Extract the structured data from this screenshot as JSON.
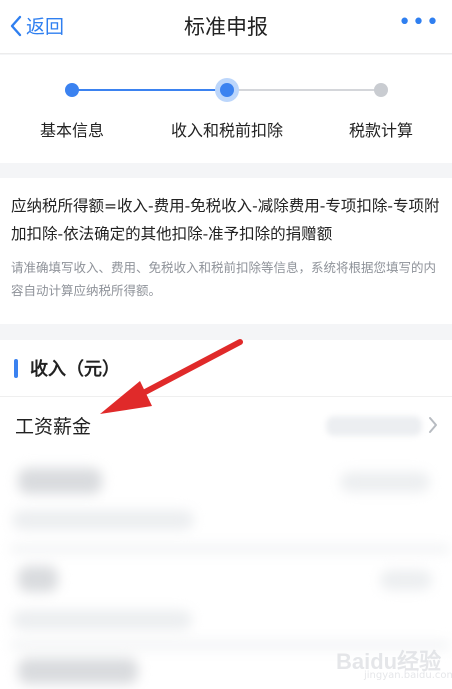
{
  "nav": {
    "back_label": "返回",
    "title": "标准申报",
    "more_label": "•••"
  },
  "steps": [
    {
      "label": "基本信息",
      "status": "done"
    },
    {
      "label": "收入和税前扣除",
      "status": "current"
    },
    {
      "label": "税款计算",
      "status": "pending"
    }
  ],
  "info": {
    "formula": "应纳税所得额=收入-费用-免税收入-减除费用-专项扣除-专项附加扣除-依法确定的其他扣除-准予扣除的捐赠额",
    "hint": "请准确填写收入、费用、免税收入和税前扣除等信息，系统将根据您填写的内容自动计算应纳税所得额。"
  },
  "income": {
    "heading": "收入（元）",
    "rows": [
      {
        "label": "工资薪金"
      }
    ]
  },
  "watermark": {
    "text": "Baidu经验",
    "sub": "jingyan.baidu.com"
  },
  "colors": {
    "accent": "#3b82f0",
    "arrow": "#e02a2a"
  }
}
